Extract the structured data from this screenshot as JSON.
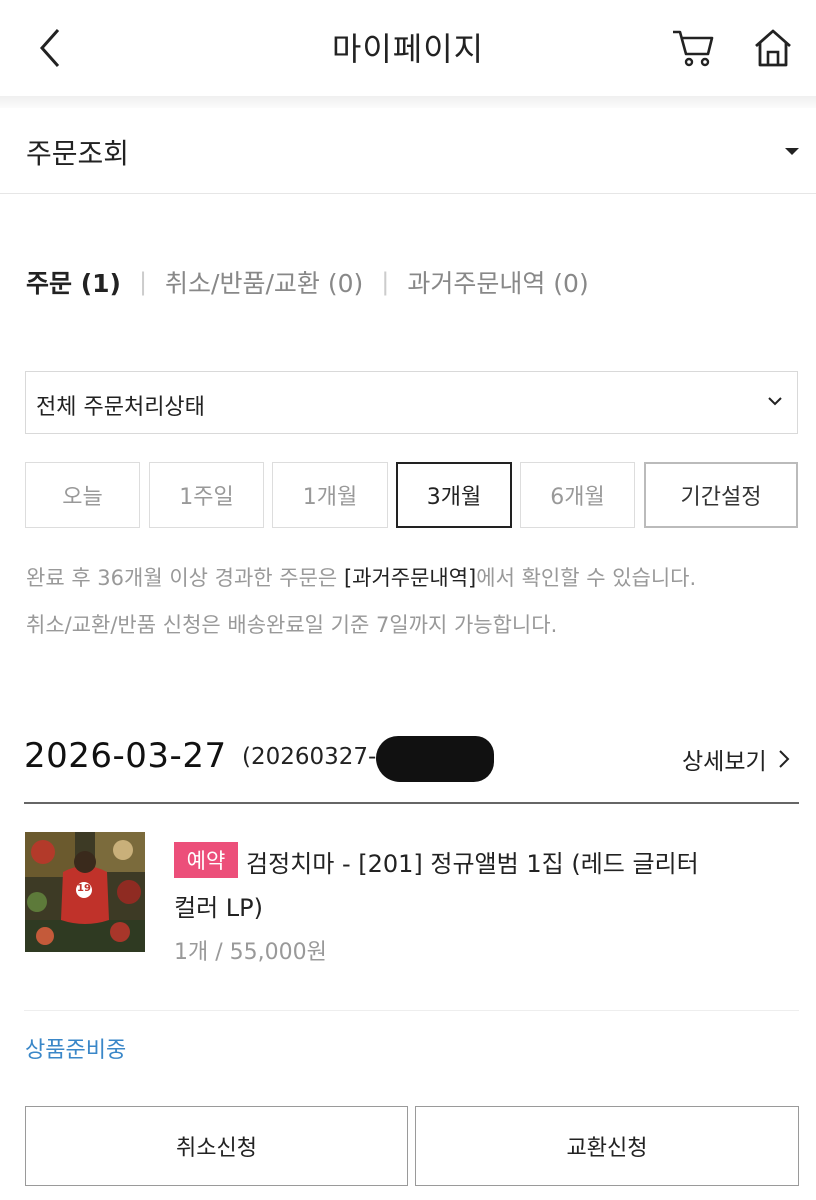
{
  "header": {
    "title": "마이페이지",
    "back_icon": "chevron-left-icon",
    "cart_icon": "cart-icon",
    "home_icon": "home-icon"
  },
  "section_select": {
    "label": "주문조회",
    "icon": "caret-down-icon"
  },
  "tabs": [
    {
      "label": "주문 (1)",
      "active": true
    },
    {
      "label": "취소/반품/교환 (0)",
      "active": false
    },
    {
      "label": "과거주문내역 (0)",
      "active": false
    }
  ],
  "tab_separator": "|",
  "status_filter": {
    "value": "전체 주문처리상태",
    "icon": "chevron-down-icon"
  },
  "periods": [
    {
      "label": "오늘",
      "selected": false
    },
    {
      "label": "1주일",
      "selected": false
    },
    {
      "label": "1개월",
      "selected": false
    },
    {
      "label": "3개월",
      "selected": true
    },
    {
      "label": "6개월",
      "selected": false
    },
    {
      "label": "기간설정",
      "selected": false
    }
  ],
  "notices": {
    "line1_pre": "완료 후 36개월 이상 경과한 주문은 ",
    "line1_highlight": "[과거주문내역]",
    "line1_post": "에서 확인할 수 있습니다.",
    "line2": "취소/교환/반품 신청은 배송완료일 기준 7일까지 가능합니다."
  },
  "order": {
    "date": "2026-03-27",
    "order_number_visible": "(20260327-",
    "detail_label": "상세보기",
    "detail_icon": "chevron-right-icon",
    "item": {
      "badge": "예약",
      "name_line1": "검정치마 - [201] 정규앨범 1집 (레드 글리터",
      "name_line2": "컬러 LP)",
      "qty_price": "1개 / 55,000원",
      "age_badge": "19"
    },
    "status": "상품준비중",
    "buttons": {
      "cancel": "취소신청",
      "exchange": "교환신청"
    }
  },
  "colors": {
    "badge_pink": "#ec4f7a",
    "status_blue": "#3a87c8",
    "text_main": "#222222",
    "text_muted": "#999999"
  }
}
